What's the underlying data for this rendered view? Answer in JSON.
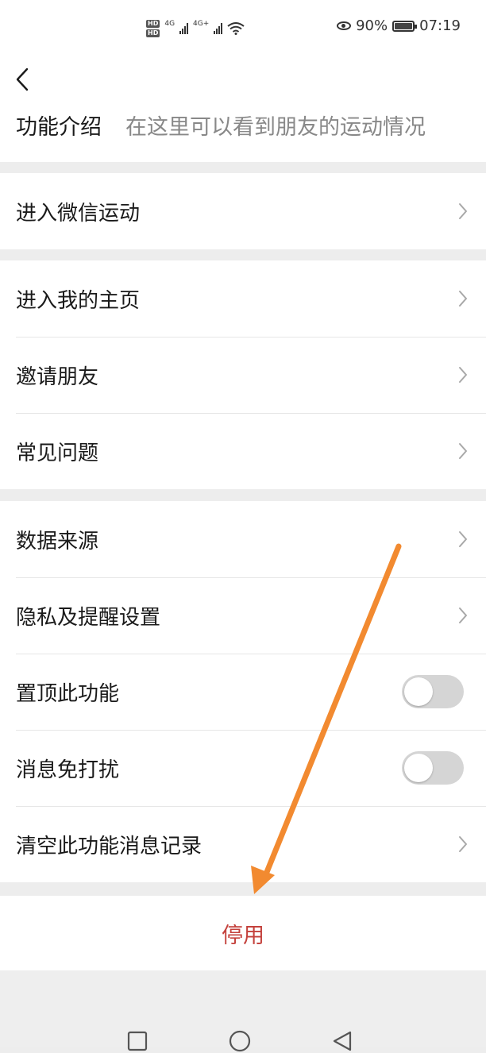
{
  "status_bar": {
    "hd_badge": "HD",
    "network_1": "4G",
    "network_2": "4G+",
    "battery": "90%",
    "time": "07:19",
    "icons": [
      "eye-icon",
      "battery-icon",
      "wifi-icon",
      "signal-icon"
    ]
  },
  "header": {
    "back_icon": "chevron-left-icon",
    "intro_label": "功能介绍",
    "intro_desc": "在这里可以看到朋友的运动情况"
  },
  "groups": [
    {
      "items": [
        {
          "label": "进入微信运动",
          "control": "chevron"
        }
      ]
    },
    {
      "items": [
        {
          "label": "进入我的主页",
          "control": "chevron"
        },
        {
          "label": "邀请朋友",
          "control": "chevron"
        },
        {
          "label": "常见问题",
          "control": "chevron"
        }
      ]
    },
    {
      "items": [
        {
          "label": "数据来源",
          "control": "chevron"
        },
        {
          "label": "隐私及提醒设置",
          "control": "chevron"
        },
        {
          "label": "置顶此功能",
          "control": "toggle",
          "on": false
        },
        {
          "label": "消息免打扰",
          "control": "toggle",
          "on": false
        },
        {
          "label": "清空此功能消息记录",
          "control": "chevron"
        }
      ]
    }
  ],
  "disable_label": "停用",
  "nav": {
    "icons": [
      "square-icon",
      "circle-icon",
      "triangle-back-icon"
    ]
  },
  "colors": {
    "background": "#ededed",
    "card": "#ffffff",
    "danger": "#c4413c",
    "secondary_text": "#888888",
    "annotation_arrow": "#f28a30"
  }
}
